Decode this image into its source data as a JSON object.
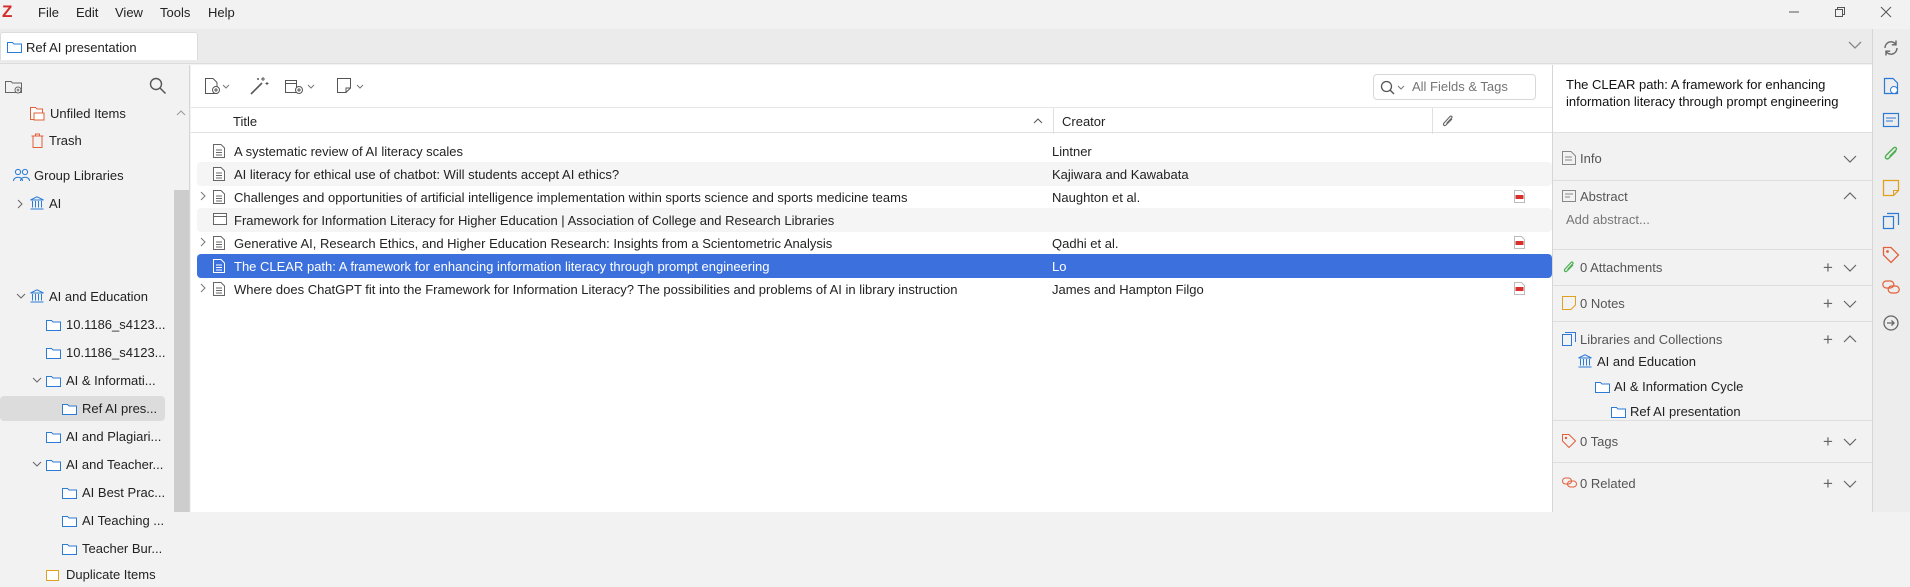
{
  "app": {
    "logo": "Z"
  },
  "menu": [
    "File",
    "Edit",
    "View",
    "Tools",
    "Help"
  ],
  "tab": {
    "label": "Ref AI presentation"
  },
  "left_tree": {
    "unfiled": "Unfiled Items",
    "trash": "Trash",
    "group_libraries": "Group Libraries",
    "items": [
      {
        "label": "AI"
      },
      {
        "label": "AI and Education"
      },
      {
        "label": "10.1186_s4123..."
      },
      {
        "label": "10.1186_s4123..."
      },
      {
        "label": "AI & Informati..."
      },
      {
        "label": "Ref AI pres..."
      },
      {
        "label": "AI and Plagiari..."
      },
      {
        "label": "AI and Teacher..."
      },
      {
        "label": "AI Best Prac..."
      },
      {
        "label": "AI Teaching ..."
      },
      {
        "label": "Teacher Bur..."
      },
      {
        "label": "Duplicate Items"
      }
    ]
  },
  "search": {
    "placeholder": "All Fields & Tags"
  },
  "columns": {
    "title": "Title",
    "creator": "Creator"
  },
  "items": [
    {
      "title": "A systematic review of AI literacy scales",
      "creator": "Lintner"
    },
    {
      "title": "AI literacy for ethical use of chatbot: Will students accept AI ethics?",
      "creator": "Kajiwara and Kawabata"
    },
    {
      "title": "Challenges and opportunities of artificial intelligence implementation within sports science and sports medicine teams",
      "creator": "Naughton et al."
    },
    {
      "title": "Framework for Information Literacy for Higher Education | Association of College and Research Libraries",
      "creator": ""
    },
    {
      "title": "Generative AI, Research Ethics, and Higher Education Research: Insights from a Scientometric Analysis",
      "creator": "Qadhi et al."
    },
    {
      "title": "The CLEAR path: A framework for enhancing information literacy through prompt engineering",
      "creator": "Lo"
    },
    {
      "title": "Where does ChatGPT fit into the Framework for Information Literacy? The possibilities and problems of AI in library instruction",
      "creator": "James and Hampton Filgo"
    }
  ],
  "item_pane": {
    "title": "The CLEAR path: A framework for enhancing information literacy through prompt engineering",
    "info": "Info",
    "abstract": "Abstract",
    "abstract_placeholder": "Add abstract...",
    "attachments": "0 Attachments",
    "notes": "0 Notes",
    "libraries": "Libraries and Collections",
    "collections": [
      "AI and Education",
      "AI & Information Cycle",
      "Ref AI presentation"
    ],
    "tags": "0 Tags",
    "related": "0 Related"
  },
  "colors": {
    "selected": "#3b70dd",
    "accent": "#2b7bd6",
    "logo": "#d42b2b",
    "pdf": "#d9302f"
  }
}
